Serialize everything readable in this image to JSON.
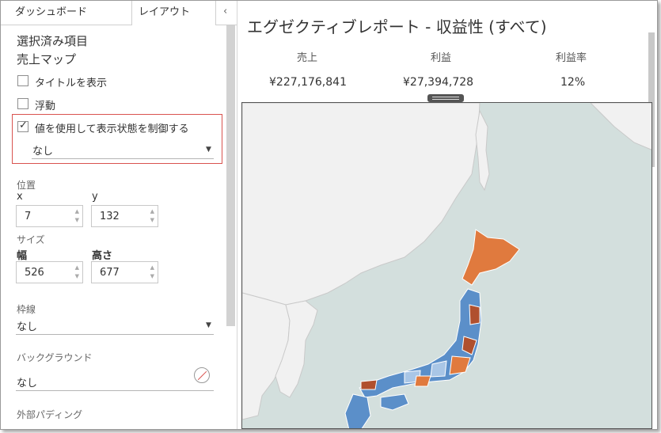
{
  "tabs": {
    "dashboard": "ダッシュボード",
    "layout": "レイアウト",
    "collapse_icon": "chevron-left"
  },
  "selected": {
    "heading": "選択済み項目",
    "name": "売上マップ"
  },
  "options": {
    "show_title": "タイトルを表示",
    "floating": "浮動",
    "control_visibility": "値を使用して表示状態を制御する",
    "control_value": "なし"
  },
  "position": {
    "label": "位置",
    "x_label": "x",
    "y_label": "y",
    "x": "7",
    "y": "132"
  },
  "size": {
    "label": "サイズ",
    "w_label": "幅",
    "h_label": "高さ",
    "w": "526",
    "h": "677"
  },
  "border": {
    "label": "枠線",
    "value": "なし"
  },
  "background": {
    "label": "バックグラウンド",
    "value": "なし"
  },
  "padding": {
    "label": "外部パディング"
  },
  "report": {
    "title": "エグゼクティブレポート - 収益性 (すべて)",
    "kpis": [
      {
        "label": "売上",
        "value": "¥227,176,841"
      },
      {
        "label": "利益",
        "value": "¥27,394,728"
      },
      {
        "label": "利益率",
        "value": "12%"
      }
    ]
  },
  "colors": {
    "sea": "#d3dfdd",
    "land": "#f1f1f1",
    "orange": "#e07a3e",
    "dark_red": "#b0502e",
    "blue": "#5b8fc9",
    "light_blue": "#a9c6e6",
    "highlight": "#d9534f"
  }
}
